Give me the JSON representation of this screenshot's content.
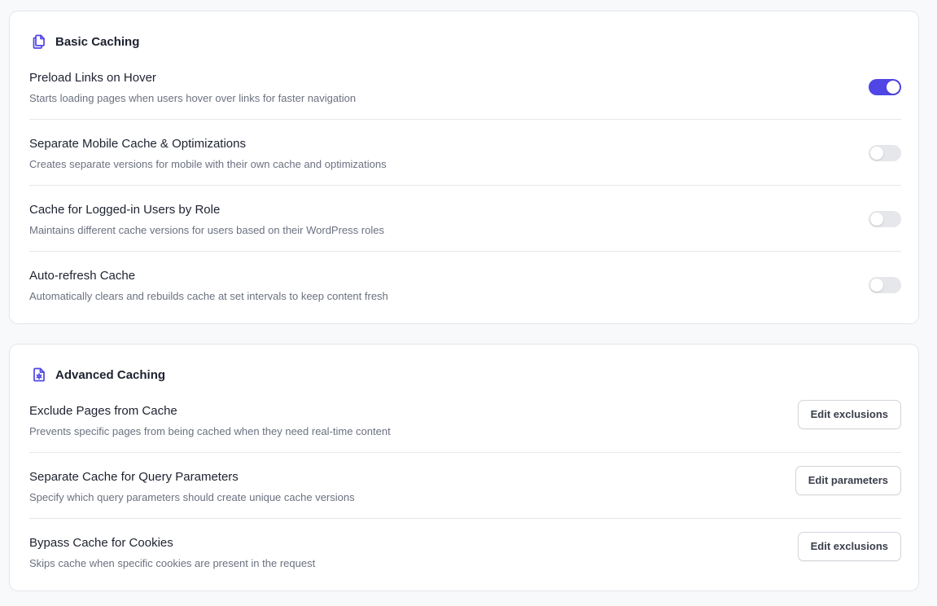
{
  "basic": {
    "title": "Basic Caching",
    "icon": "copy-pages-icon",
    "items": [
      {
        "title": "Preload Links on Hover",
        "description": "Starts loading pages when users hover over links for faster navigation",
        "enabled": true
      },
      {
        "title": "Separate Mobile Cache & Optimizations",
        "description": "Creates separate versions for mobile with their own cache and optimizations",
        "enabled": false
      },
      {
        "title": "Cache for Logged-in Users by Role",
        "description": "Maintains different cache versions for users based on their WordPress roles",
        "enabled": false
      },
      {
        "title": "Auto-refresh Cache",
        "description": "Automatically clears and rebuilds cache at set intervals to keep content fresh",
        "enabled": false
      }
    ]
  },
  "advanced": {
    "title": "Advanced Caching",
    "icon": "file-settings-icon",
    "items": [
      {
        "title": "Exclude Pages from Cache",
        "description": "Prevents specific pages from being cached when they need real-time content",
        "button_label": "Edit exclusions"
      },
      {
        "title": "Separate Cache for Query Parameters",
        "description": "Specify which query parameters should create unique cache versions",
        "button_label": "Edit parameters"
      },
      {
        "title": "Bypass Cache for Cookies",
        "description": "Skips cache when specific cookies are present in the request",
        "button_label": "Edit exclusions"
      }
    ]
  },
  "colors": {
    "accent": "#4f46e5",
    "toggle_off": "#e6e7eb",
    "text_primary": "#1d2230",
    "text_secondary": "#6b7180"
  }
}
